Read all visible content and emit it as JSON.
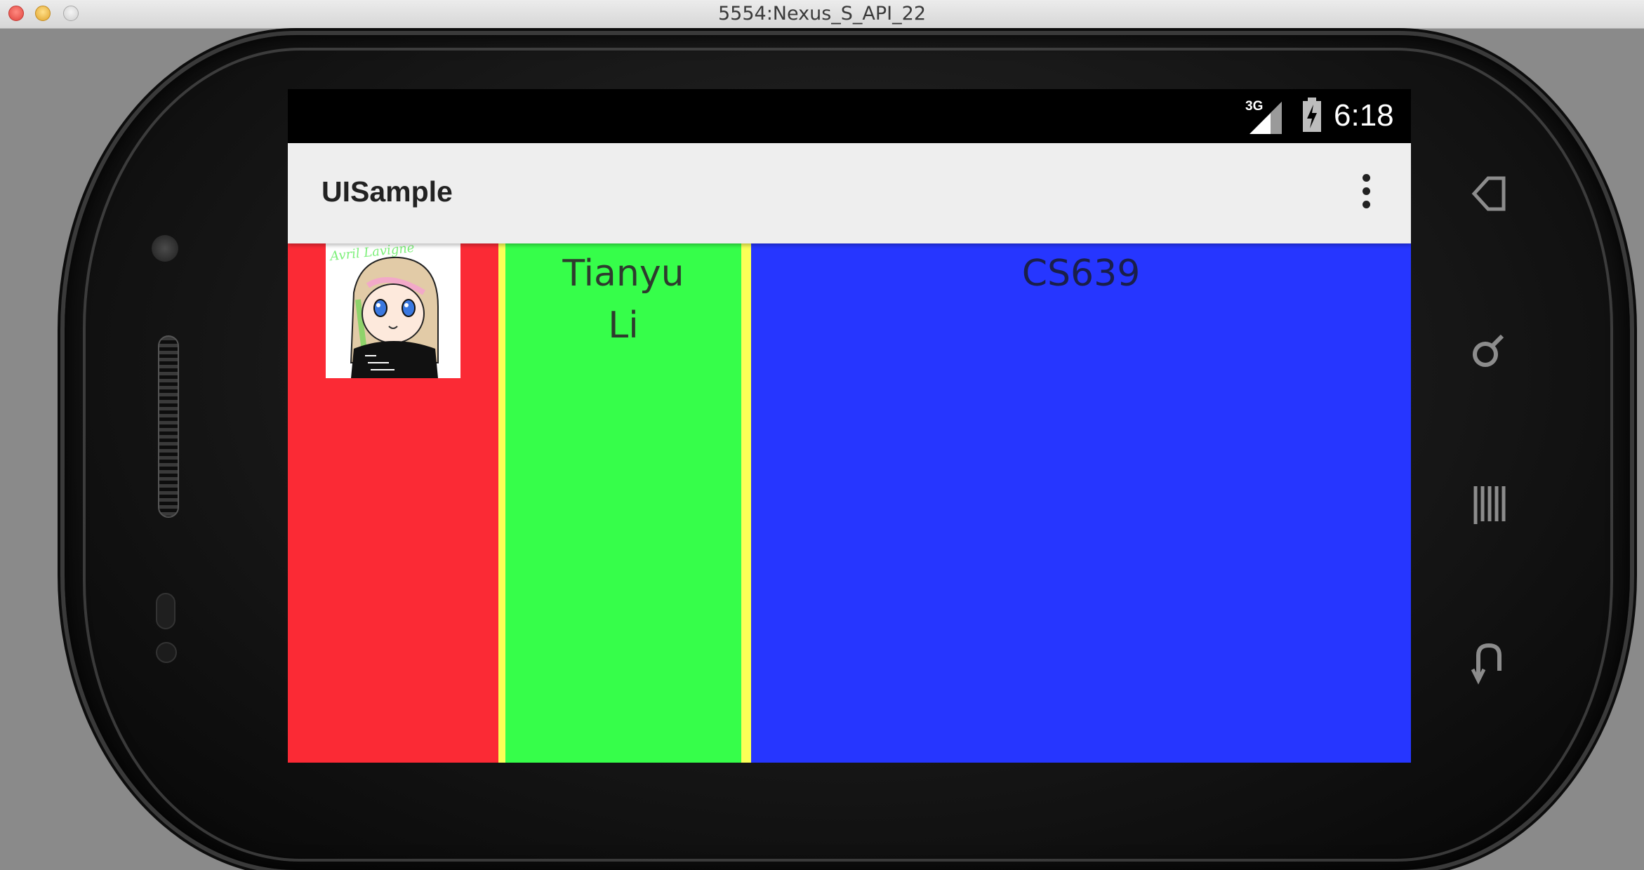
{
  "window": {
    "title": "5554:Nexus_S_API_22"
  },
  "status_bar": {
    "network": "3G",
    "time": "6:18"
  },
  "app_bar": {
    "title": "UISample",
    "overflow_icon": "more-vert-icon"
  },
  "columns": {
    "left": {
      "color": "#fb2a35",
      "image": {
        "caption": "Avril Lavigne",
        "icon": "avatar-image"
      }
    },
    "middle": {
      "color": "#36fe4a",
      "border_color": "#fbff57",
      "text": "Tianyu Li"
    },
    "right": {
      "color": "#2636ff",
      "text": "CS639"
    }
  },
  "hardware_keys": [
    "home-icon",
    "search-icon",
    "menu-icon",
    "back-icon"
  ]
}
